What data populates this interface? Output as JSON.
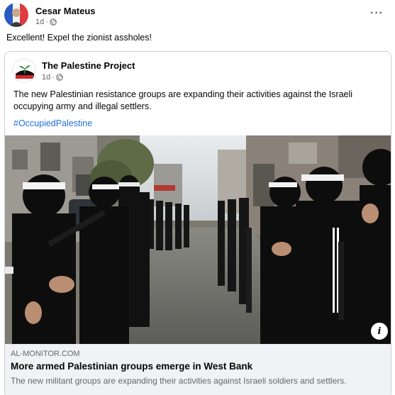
{
  "post": {
    "author": "Cesar Mateus",
    "timestamp": "1d",
    "privacy_icon": "globe-icon",
    "more_label": "···",
    "text": "Excellent! Expel the zionist assholes!"
  },
  "shared_post": {
    "page_name": "The Palestine Project",
    "timestamp": "1d",
    "privacy_icon": "globe-icon",
    "text": "The new Palestinian resistance groups are expanding their activities against the Israeli occupying army and illegal settlers.",
    "hashtag": "#OccupiedPalestine",
    "page_logo_text": "PALESTINE"
  },
  "link_preview": {
    "domain": "AL-MONITOR.COM",
    "title": "More armed Palestinian groups emerge in West Bank",
    "description": "The new militant groups are expanding their activities against Israeli soldiers and settlers.",
    "info_label": "i"
  },
  "colors": {
    "link_blue": "#216fdb",
    "secondary_text": "#65676b",
    "footer_bg": "#f0f2f5"
  }
}
